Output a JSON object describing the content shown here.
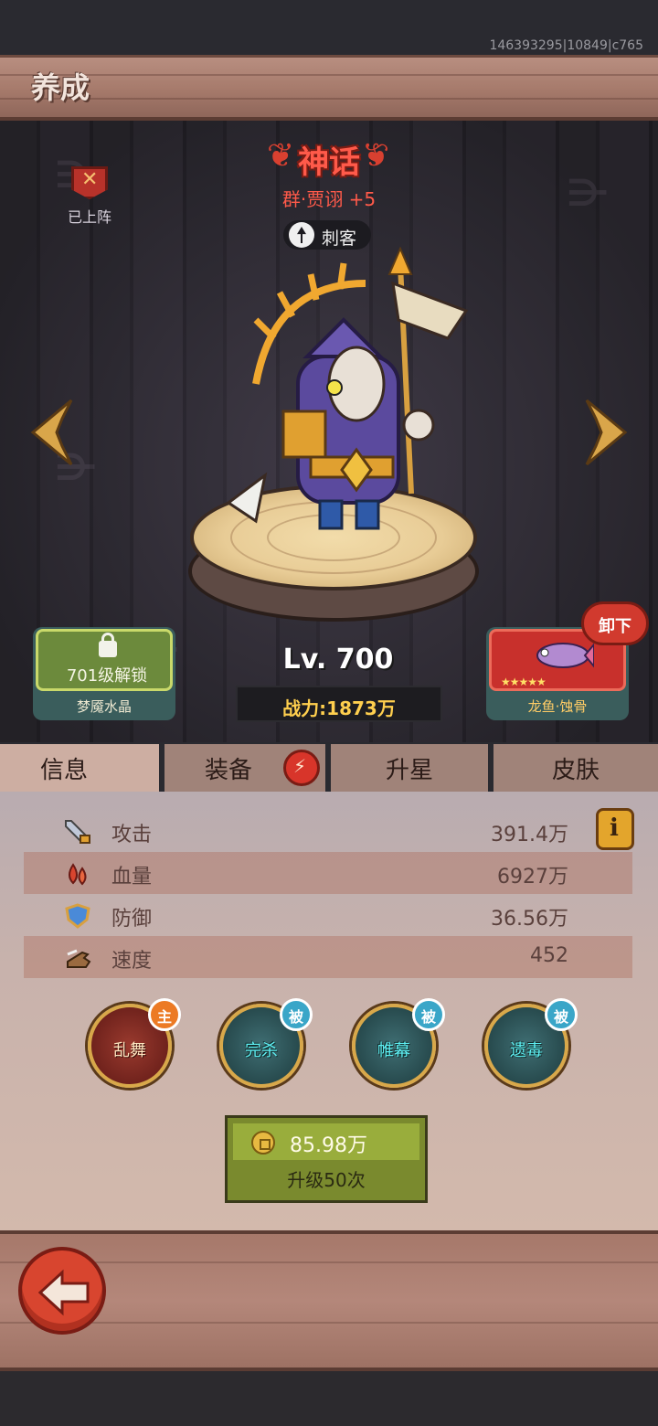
{
  "debug_id": "146393295|10849|c765",
  "header": {
    "title": "养成"
  },
  "hero": {
    "rarity": "神话",
    "name": "群·贾诩 +5",
    "class": "刺客",
    "class_icon": "assassin-dagger-icon",
    "deployed_label": "已上阵",
    "level": "Lv. 700",
    "power": "战力:1873万"
  },
  "unlock_slot": {
    "text": "701级解锁",
    "label": "梦魇水晶",
    "icon": "lock-icon"
  },
  "pet": {
    "name": "龙鱼·蚀骨",
    "stars": "★★★★★",
    "unequip_label": "卸下"
  },
  "tabs": [
    {
      "label": "信息",
      "active": true
    },
    {
      "label": "装备",
      "active": false,
      "badge": true
    },
    {
      "label": "升星",
      "active": false
    },
    {
      "label": "皮肤",
      "active": false
    }
  ],
  "stats": [
    {
      "label": "攻击",
      "value": "391.4万",
      "icon": "sword-icon"
    },
    {
      "label": "血量",
      "value": "6927万",
      "icon": "blood-icon"
    },
    {
      "label": "防御",
      "value": "36.56万",
      "icon": "shield-icon"
    },
    {
      "label": "速度",
      "value": "452",
      "icon": "boot-icon"
    }
  ],
  "info_button": "i",
  "skills": [
    {
      "name": "乱舞",
      "badge": "主",
      "type": "active"
    },
    {
      "name": "完杀",
      "badge": "被",
      "type": "passive"
    },
    {
      "name": "帷幕",
      "badge": "被",
      "type": "passive"
    },
    {
      "name": "遗毒",
      "badge": "被",
      "type": "passive"
    }
  ],
  "upgrade": {
    "cost": "85.98万",
    "label": "升级50次"
  },
  "colors": {
    "rarity_red": "#ff5a4a",
    "power_gold": "#ffcf4e",
    "panel": "#cdaea2",
    "upgrade_green": "#99ad3c"
  }
}
